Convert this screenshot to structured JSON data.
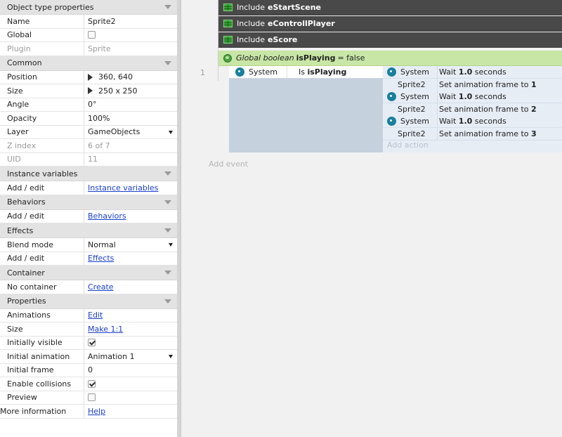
{
  "properties": {
    "rows": [
      {
        "type": "section",
        "label": "Object type properties"
      },
      {
        "type": "prop",
        "label": "Name",
        "value": "Sprite2"
      },
      {
        "type": "check",
        "label": "Global",
        "checked": false
      },
      {
        "type": "prop",
        "label": "Plugin",
        "value": "Sprite",
        "dim": true
      },
      {
        "type": "section",
        "label": "Common"
      },
      {
        "type": "expand",
        "label": "Position",
        "value": "360, 640"
      },
      {
        "type": "expand",
        "label": "Size",
        "value": "250 x 250"
      },
      {
        "type": "prop",
        "label": "Angle",
        "value": "0°"
      },
      {
        "type": "prop",
        "label": "Opacity",
        "value": "100%"
      },
      {
        "type": "dropdown",
        "label": "Layer",
        "value": "GameObjects"
      },
      {
        "type": "prop",
        "label": "Z index",
        "value": "6 of 7",
        "dim": true
      },
      {
        "type": "prop",
        "label": "UID",
        "value": "11",
        "dim": true
      },
      {
        "type": "section",
        "label": "Instance variables"
      },
      {
        "type": "link",
        "label": "Add / edit",
        "value": "Instance variables"
      },
      {
        "type": "section",
        "label": "Behaviors"
      },
      {
        "type": "link",
        "label": "Add / edit",
        "value": "Behaviors"
      },
      {
        "type": "section",
        "label": "Effects"
      },
      {
        "type": "dropdown",
        "label": "Blend mode",
        "value": "Normal"
      },
      {
        "type": "link",
        "label": "Add / edit",
        "value": "Effects"
      },
      {
        "type": "section",
        "label": "Container"
      },
      {
        "type": "link",
        "label": "No container",
        "value": "Create"
      },
      {
        "type": "section",
        "label": "Properties"
      },
      {
        "type": "link",
        "label": "Animations",
        "value": "Edit"
      },
      {
        "type": "link",
        "label": "Size",
        "value": "Make 1:1"
      },
      {
        "type": "check",
        "label": "Initially visible",
        "checked": true
      },
      {
        "type": "dropdown",
        "label": "Initial animation",
        "value": "Animation 1"
      },
      {
        "type": "prop",
        "label": "Initial frame",
        "value": "0"
      },
      {
        "type": "check",
        "label": "Enable collisions",
        "checked": true
      },
      {
        "type": "check",
        "label": "Preview",
        "checked": false
      },
      {
        "type": "link",
        "label": "More information",
        "value": "Help"
      }
    ]
  },
  "includes": [
    {
      "prefix": "Include",
      "name": "eStartScene"
    },
    {
      "prefix": "Include",
      "name": "eControllPlayer"
    },
    {
      "prefix": "Include",
      "name": "eScore"
    }
  ],
  "global_var": {
    "prefix": "Global boolean",
    "name": "isPlaying",
    "suffix": "= false"
  },
  "event": {
    "number": "1",
    "condition": {
      "object": "System",
      "prefix": "Is",
      "name": "isPlaying"
    },
    "actions": [
      {
        "object": "System",
        "icon": true,
        "pre": "Wait",
        "bold": "1.0",
        "post": "seconds"
      },
      {
        "object": "Sprite2",
        "icon": false,
        "pre": "Set animation frame to",
        "bold": "1",
        "post": ""
      },
      {
        "object": "System",
        "icon": true,
        "pre": "Wait",
        "bold": "1.0",
        "post": "seconds"
      },
      {
        "object": "Sprite2",
        "icon": false,
        "pre": "Set animation frame to",
        "bold": "2",
        "post": ""
      },
      {
        "object": "System",
        "icon": true,
        "pre": "Wait",
        "bold": "1.0",
        "post": "seconds"
      },
      {
        "object": "Sprite2",
        "icon": false,
        "pre": "Set animation frame to",
        "bold": "3",
        "post": ""
      }
    ],
    "add_action": "Add action"
  },
  "add_event": "Add event"
}
